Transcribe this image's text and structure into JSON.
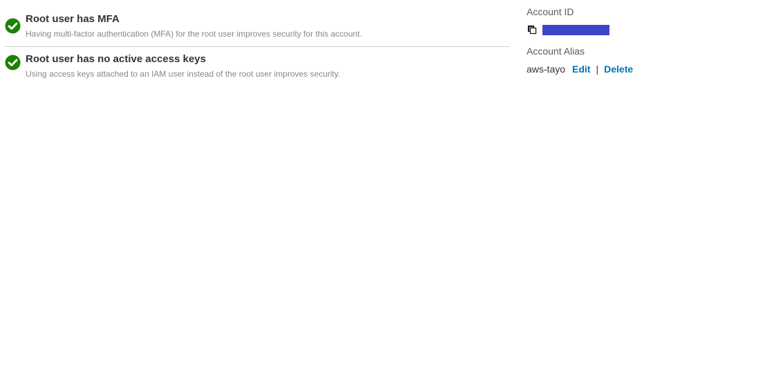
{
  "recommendations": [
    {
      "title": "Root user has MFA",
      "description": "Having multi-factor authentication (MFA) for the root user improves security for this account.",
      "icon": "check-circle-icon",
      "status_color": "#1d8102"
    },
    {
      "title": "Root user has no active access keys",
      "description": "Using access keys attached to an IAM user instead of the root user improves security.",
      "icon": "check-circle-icon",
      "status_color": "#1d8102"
    }
  ],
  "account": {
    "id_label": "Account ID",
    "copy_icon": "copy-icon",
    "id_redaction_color": "#3c46c8",
    "alias_label": "Account Alias",
    "alias_value": "aws-tayo",
    "edit_label": "Edit",
    "separator": "|",
    "delete_label": "Delete",
    "link_color": "#0073bb"
  }
}
